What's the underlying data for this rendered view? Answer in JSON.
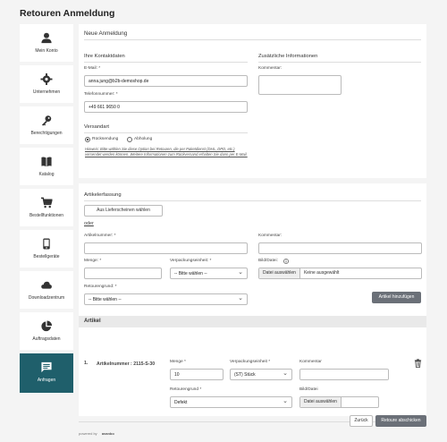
{
  "page": {
    "title": "Retouren Anmeldung"
  },
  "sidebar": {
    "items": [
      {
        "label": "Mein Konto",
        "icon": "person-icon"
      },
      {
        "label": "Unternehmen",
        "icon": "gear-icon"
      },
      {
        "label": "Berechtigungen",
        "icon": "key-icon"
      },
      {
        "label": "Katalog",
        "icon": "book-icon"
      },
      {
        "label": "Bestellfunktionen",
        "icon": "cart-icon"
      },
      {
        "label": "Bestellgeräte",
        "icon": "device-icon"
      },
      {
        "label": "Downloadzentrum",
        "icon": "cloud-icon"
      },
      {
        "label": "Auftragsdaten",
        "icon": "pie-chart-icon"
      },
      {
        "label": "Anfragen",
        "icon": "chat-icon"
      }
    ]
  },
  "form": {
    "heading": "Neue Anmeldung",
    "contact_heading": "Ihre Kontaktdaten",
    "extra_heading": "Zusätzliche Informationen",
    "email_label": "E-Mail: *",
    "email_value": "anna.jung@b2b-demoshop.de",
    "phone_label": "Telefonnummer: *",
    "phone_value": "+49 661 9650 0",
    "comment_label": "Kommentar:",
    "shipping_heading": "Versandart",
    "opt_send": "Rücksendung",
    "opt_pickup": "Abholung",
    "note": "Hinweis: Bitte wählen Sie diese Option bei Retouren, die per Paketdienst (DHL, DPD, etc.) versendet werden können. Weitere Informationen zum Rückversand erhalten Sie dann per E-Mail."
  },
  "capture": {
    "heading": "Artikelerfassung",
    "from_delivery_btn": "Aus Lieferscheinen wählen",
    "or": "oder",
    "article_label": "Artikelnummer: *",
    "comment_label": "Kommentar:",
    "qty_label": "Menge: *",
    "pack_label": "Verpackungseinheit: *",
    "pack_placeholder": "-- Bitte wählen --",
    "file_label": "Bild/Datei:",
    "file_btn": "Datei auswählen",
    "file_none": "Keine ausgewählt",
    "reason_label": "Retourengrund: *",
    "reason_placeholder": "-- Bitte wählen --",
    "add_btn": "Artikel hinzufügen"
  },
  "articles": {
    "heading": "Artikel",
    "rows": [
      {
        "index": "1.",
        "article_text": "Artikelnummer : 2115-S-30",
        "qty_label": "Menge *",
        "qty_value": "10",
        "pack_label": "Verpackungseinheit *",
        "pack_value": "(ST) Stück",
        "comment_label": "Kommentar",
        "reason_label": "Retourengrund *",
        "reason_value": "Defekt",
        "file_label": "Bild/Datei",
        "file_btn": "Datei auswählen"
      }
    ]
  },
  "actions": {
    "back": "Zurück",
    "submit": "Retoure abschicken"
  },
  "footer": {
    "powered": "powered by",
    "brand": "avanbo"
  }
}
